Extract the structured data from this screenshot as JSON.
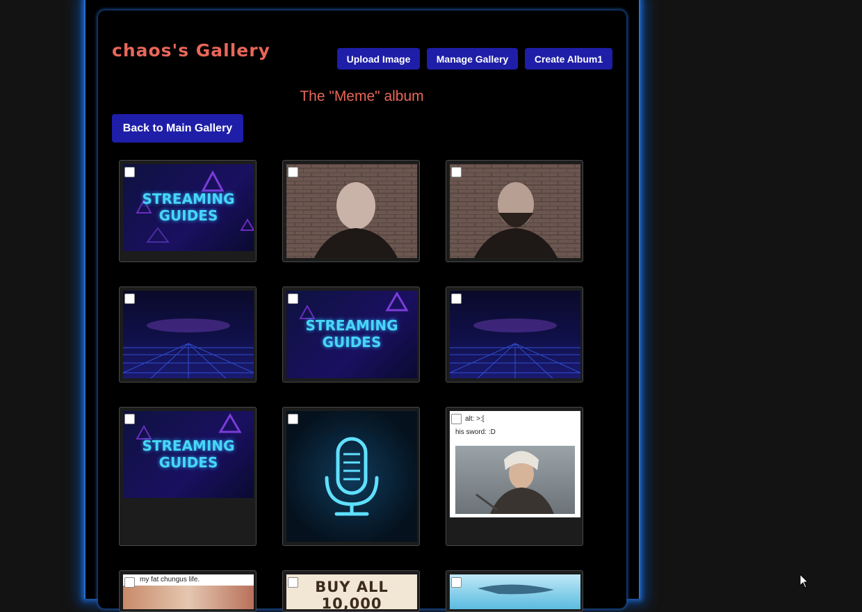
{
  "header": {
    "title": "chaos's Gallery",
    "buttons": {
      "upload": "Upload Image",
      "manage": "Manage Gallery",
      "create_album": "Create Album1"
    }
  },
  "album": {
    "title": "The \"Meme\" album",
    "back_label": "Back to Main Gallery"
  },
  "thumbnails": [
    {
      "kind": "streaming-guides",
      "text": [
        "STREAMING",
        "GUIDES"
      ]
    },
    {
      "kind": "man-photo-1"
    },
    {
      "kind": "man-photo-2"
    },
    {
      "kind": "synthwave-grid"
    },
    {
      "kind": "streaming-guides",
      "text": [
        "STREAMING",
        "GUIDES"
      ]
    },
    {
      "kind": "synthwave-grid"
    },
    {
      "kind": "streaming-guides",
      "text": [
        "STREAMING",
        "GUIDES"
      ]
    },
    {
      "kind": "neon-microphone"
    },
    {
      "kind": "witcher-meme",
      "text": [
        "alt: >:[",
        "his sword: :D"
      ]
    },
    {
      "kind": "text-meme",
      "text": [
        "my fat chungus life."
      ]
    },
    {
      "kind": "ad-meme",
      "text": [
        "BUY ALL 10,000"
      ]
    },
    {
      "kind": "swimmer-photo"
    }
  ],
  "colors": {
    "accent": "#e8675a",
    "button": "#1e1ea8",
    "glow": "#1f5fb0"
  }
}
